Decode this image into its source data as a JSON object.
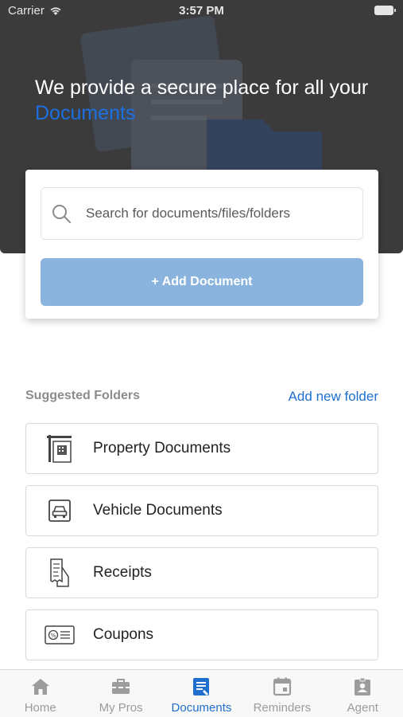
{
  "status_bar": {
    "carrier": "Carrier",
    "time": "3:57 PM"
  },
  "hero": {
    "title_prefix": "We provide a secure place for all your",
    "title_accent": "Documents"
  },
  "search": {
    "placeholder": "Search for documents/files/folders"
  },
  "actions": {
    "add_document": "+ Add Document"
  },
  "folders_section": {
    "title": "Suggested Folders",
    "add_link": "Add new folder",
    "items": [
      {
        "label": "Property Documents",
        "icon": "building-icon"
      },
      {
        "label": "Vehicle Documents",
        "icon": "car-icon"
      },
      {
        "label": "Receipts",
        "icon": "receipt-icon"
      },
      {
        "label": "Coupons",
        "icon": "coupon-icon"
      }
    ]
  },
  "tabbar": {
    "active": "Documents",
    "tabs": [
      {
        "label": "Home",
        "icon": "home-icon"
      },
      {
        "label": "My Pros",
        "icon": "toolbox-icon"
      },
      {
        "label": "Documents",
        "icon": "document-icon"
      },
      {
        "label": "Reminders",
        "icon": "calendar-icon"
      },
      {
        "label": "Agent",
        "icon": "agent-badge-icon"
      }
    ]
  },
  "colors": {
    "accent": "#1e6fd0",
    "hero_bg": "#3b3b3b",
    "button_bg": "#8ab4dd"
  }
}
